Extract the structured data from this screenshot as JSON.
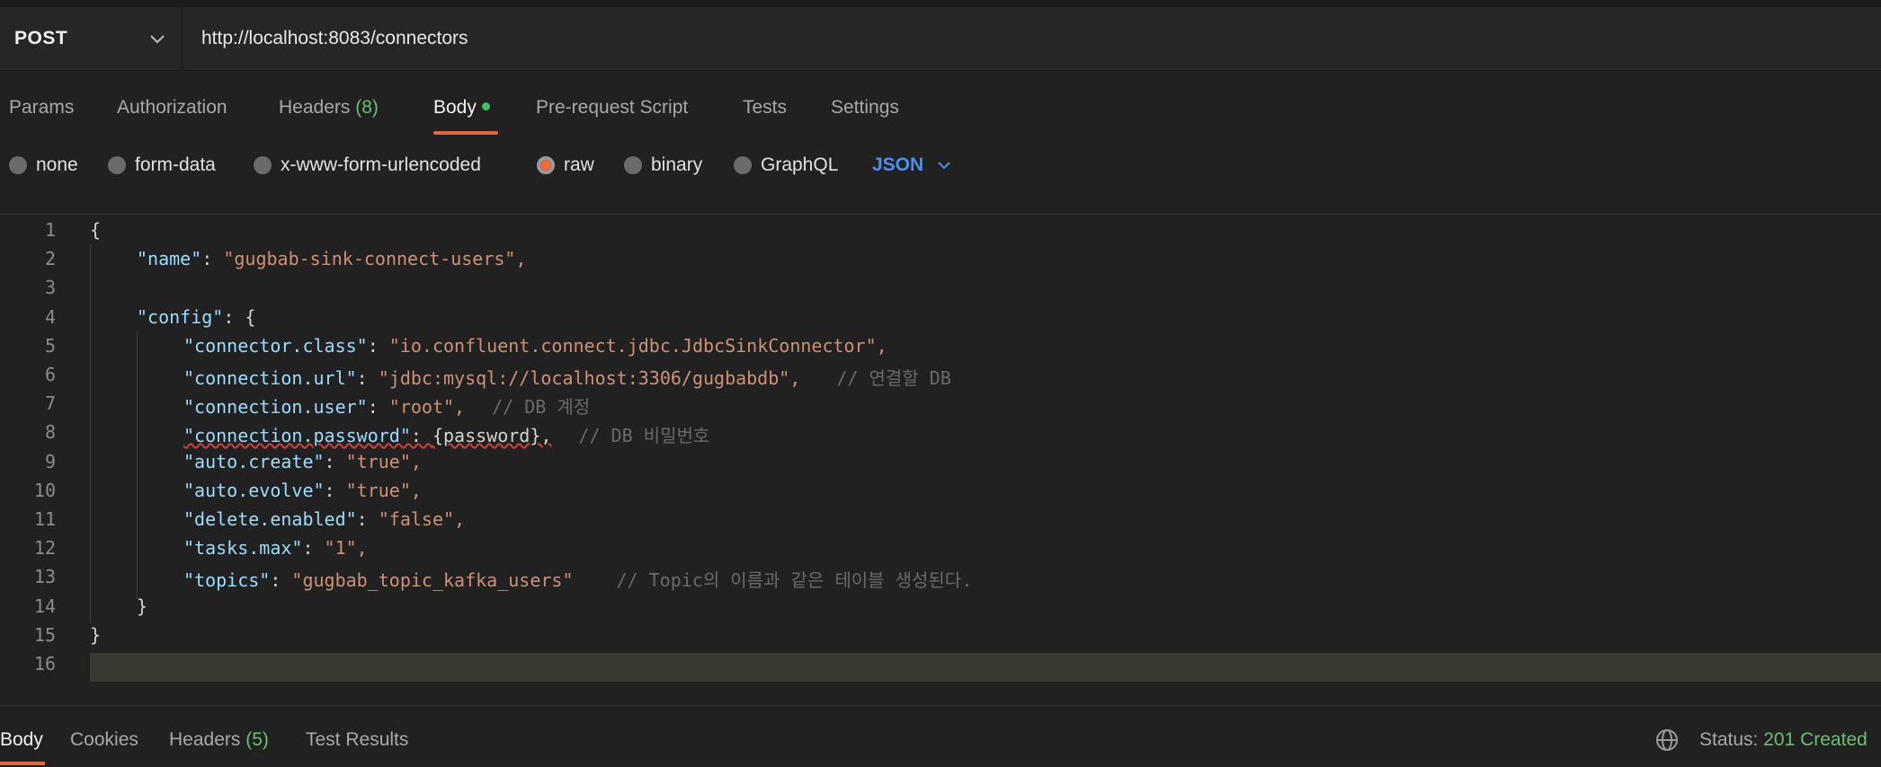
{
  "request": {
    "method": "POST",
    "url": "http://localhost:8083/connectors"
  },
  "tabs": [
    {
      "label": "Params"
    },
    {
      "label": "Authorization"
    },
    {
      "label": "Headers",
      "count": "(8)"
    },
    {
      "label": "Body",
      "active": true
    },
    {
      "label": "Pre-request Script"
    },
    {
      "label": "Tests"
    },
    {
      "label": "Settings"
    }
  ],
  "body_options": {
    "items": [
      "none",
      "form-data",
      "x-www-form-urlencoded",
      "raw",
      "binary",
      "GraphQL"
    ],
    "selected": "raw",
    "format": "JSON"
  },
  "editor": {
    "line_numbers": [
      "1",
      "2",
      "3",
      "4",
      "5",
      "6",
      "7",
      "8",
      "9",
      "10",
      "11",
      "12",
      "13",
      "14",
      "15",
      "16"
    ],
    "lines": [
      "{",
      "\"name\": \"gugbab-sink-connect-users\",",
      "",
      "\"config\": {",
      "\"connector.class\": \"io.confluent.connect.jdbc.JdbcSinkConnector\",",
      "\"connection.url\": \"jdbc:mysql://localhost:3306/gugbabdb\",",
      "\"connection.user\": \"root\",",
      "\"connection.password\": {password},",
      "\"auto.create\": \"true\",",
      "\"auto.evolve\": \"true\",",
      "\"delete.enabled\": \"false\",",
      "\"tasks.max\": \"1\",",
      "\"topics\": \"gugbab_topic_kafka_users\"",
      "}",
      "}",
      ""
    ],
    "comments": {
      "line6": "// 연결할 DB",
      "line7": "// DB 계정",
      "line8": "// DB 비밀번호",
      "line13": "// Topic의 이름과 같은 테이블 생성된다."
    }
  },
  "response": {
    "tabs": [
      {
        "label": "Body",
        "active": true
      },
      {
        "label": "Cookies"
      },
      {
        "label": "Headers",
        "count": "(5)"
      },
      {
        "label": "Test Results"
      }
    ],
    "status_label": "Status:",
    "status_value": "201 Created"
  },
  "colors": {
    "accent": "#e0683f",
    "json_blue": "#4f8ef0",
    "success_green": "#6bbf73"
  },
  "icons": [
    "chevron-down-icon",
    "radio-icon",
    "globe-icon"
  ]
}
